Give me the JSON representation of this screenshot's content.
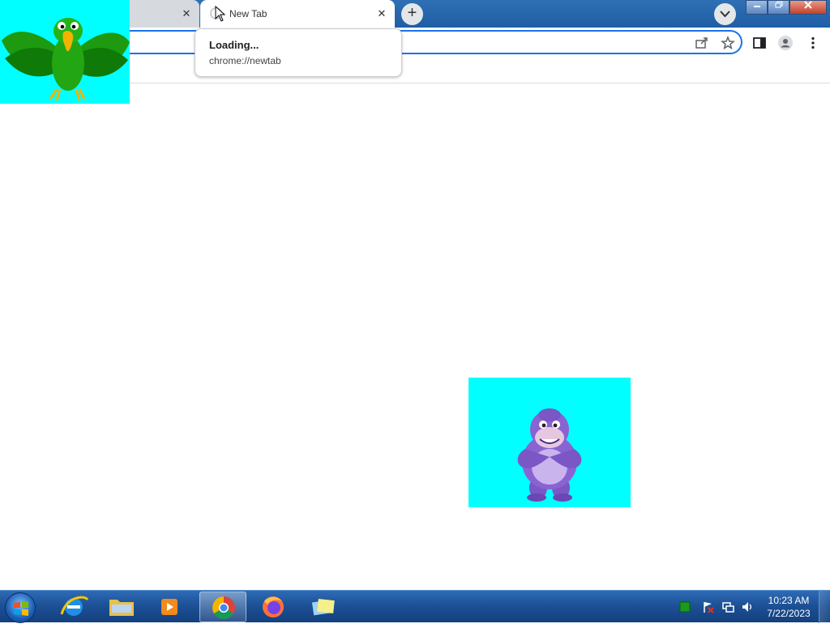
{
  "browser": {
    "tabs": [
      {
        "title": "",
        "active": false
      },
      {
        "title": "New Tab",
        "active": true
      }
    ],
    "close_glyph": "✕",
    "new_tab_glyph": "+",
    "hover_card": {
      "title": "Loading...",
      "url": "chrome://newtab"
    },
    "window_buttons": [
      "minimize",
      "restore",
      "close"
    ],
    "toolbar_icons": [
      "share-icon",
      "bookmark-star-icon",
      "side-panel-icon",
      "profile-icon",
      "menu-icon"
    ]
  },
  "desktop": {
    "overlays": [
      "parrot-character",
      "purple-gorilla-character"
    ],
    "overlay_bg": "#00ffff"
  },
  "taskbar": {
    "apps": [
      "internet-explorer",
      "windows-explorer",
      "media-player",
      "google-chrome",
      "firefox",
      "sticky-notes"
    ],
    "active_app": "google-chrome",
    "clock": {
      "time": "10:23 AM",
      "date": "7/22/2023"
    }
  },
  "colors": {
    "accent": "#1a73e8",
    "taskbar": "#1c4f93",
    "chroma": "#00ffff"
  }
}
